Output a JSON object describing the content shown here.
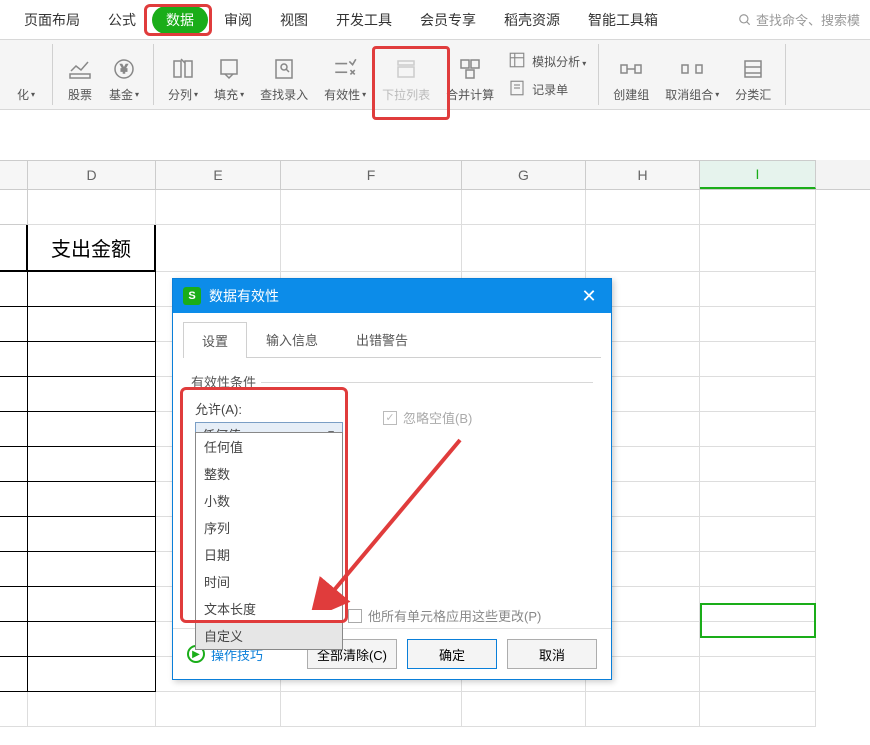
{
  "tabs": [
    "页面布局",
    "公式",
    "数据",
    "审阅",
    "视图",
    "开发工具",
    "会员专享",
    "稻壳资源",
    "智能工具箱"
  ],
  "active_tab": "数据",
  "search_placeholder": "查找命令、搜索模",
  "ribbon": {
    "stock": "股票",
    "fund": "基金",
    "split": "分列",
    "fill": "填充",
    "lookup": "查找录入",
    "validity": "有效性",
    "dropdown": "下拉列表",
    "consolidate": "合并计算",
    "simulate": "模拟分析",
    "record": "记录单",
    "group": "创建组",
    "ungroup": "取消组合",
    "subtotal": "分类汇",
    "convert": "化"
  },
  "columns": [
    "D",
    "E",
    "F",
    "G",
    "H",
    "I"
  ],
  "selected_column": "I",
  "cell_D2": "支出金额",
  "dialog": {
    "title": "数据有效性",
    "title_icon": "S",
    "tabs": [
      "设置",
      "输入信息",
      "出错警告"
    ],
    "active_tab": "设置",
    "fieldset": "有效性条件",
    "allow_label": "允许(A):",
    "selected_option": "任何值",
    "options": [
      "任何值",
      "整数",
      "小数",
      "序列",
      "日期",
      "时间",
      "文本长度",
      "自定义"
    ],
    "hover_option": "自定义",
    "ignore_blank": "忽略空值(B)",
    "apply_all": "他所有单元格应用这些更改(P)",
    "tip": "操作技巧",
    "clear_all": "全部清除(C)",
    "ok": "确定",
    "cancel": "取消"
  }
}
